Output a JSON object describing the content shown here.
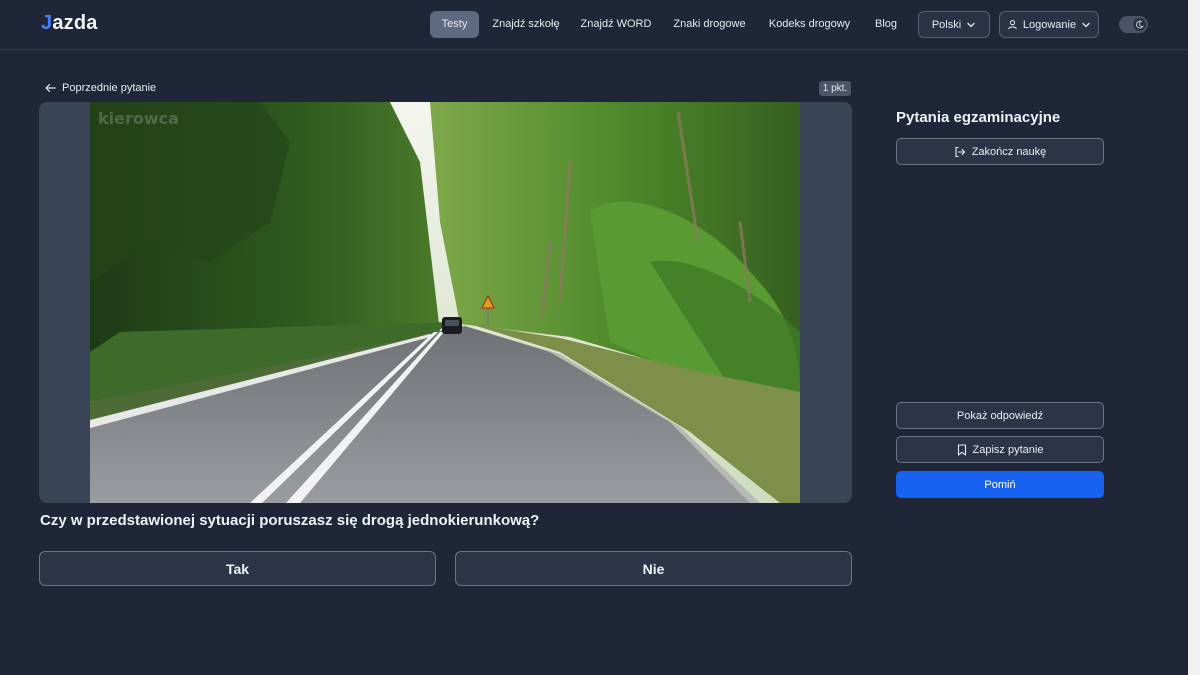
{
  "brand": {
    "logo_j": "J",
    "logo_rest": "azda"
  },
  "nav": {
    "items": [
      {
        "label": "Testy",
        "active": true
      },
      {
        "label": "Znajdź szkołę"
      },
      {
        "label": "Znajdź WORD"
      },
      {
        "label": "Znaki drogowe"
      },
      {
        "label": "Kodeks drogowy"
      },
      {
        "label": "Blog"
      }
    ],
    "language": "Polski",
    "login": "Logowanie"
  },
  "question": {
    "prev_label": "Poprzednie pytanie",
    "points": "1 pkt.",
    "watermark": "kierowca",
    "text": "Czy w przedstawionej sytuacji poruszasz się drogą jednokierunkową?",
    "answers": [
      "Tak",
      "Nie"
    ]
  },
  "sidebar": {
    "title": "Pytania egzaminacyjne",
    "end_label": "Zakończ naukę",
    "show_answer": "Pokaż odpowiedź",
    "save_question": "Zapisz pytanie",
    "skip": "Pomiń"
  },
  "colors": {
    "background": "#1f2637",
    "accent": "#1762f0",
    "logo_accent": "#4a7cf5"
  }
}
